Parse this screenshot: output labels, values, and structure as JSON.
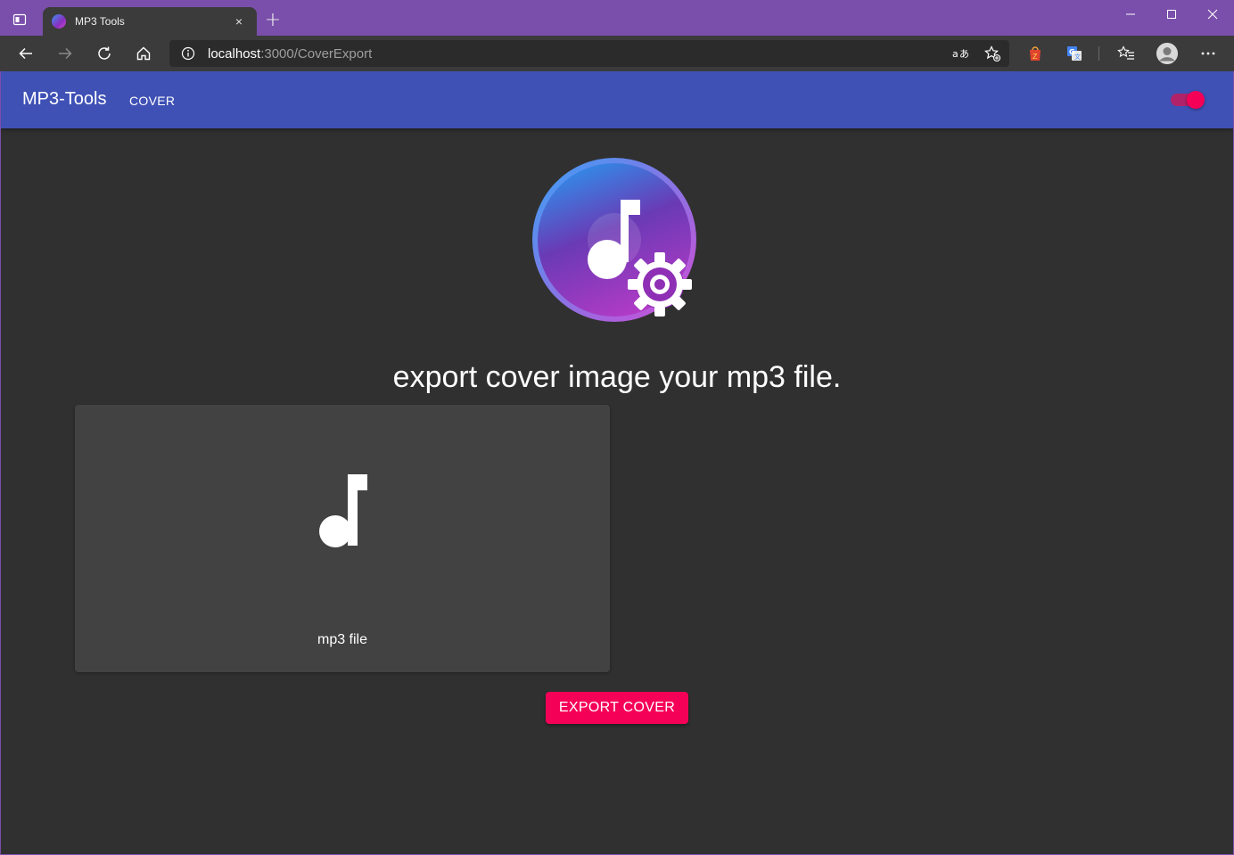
{
  "browser": {
    "tab_title": "MP3 Tools",
    "tab_close": "×",
    "new_tab": "+",
    "address_host": "localhost",
    "address_path": ":3000/CoverExport"
  },
  "app": {
    "title": "MP3-Tools",
    "nav_cover": "COVER",
    "theme_toggle_on": true
  },
  "main": {
    "headline": "export cover image your mp3 file.",
    "dropzone_label": "mp3 file",
    "export_button": "EXPORT COVER"
  },
  "colors": {
    "appbar": "#3f51b5",
    "accent": "#f50057",
    "background": "#303030",
    "card": "#424242",
    "window_frame": "#7a4fab"
  },
  "icons": [
    "tab-actions-icon",
    "app-favicon-icon",
    "minimize-icon",
    "maximize-icon",
    "close-window-icon",
    "back-icon",
    "forward-icon",
    "refresh-icon",
    "home-icon",
    "info-icon",
    "read-aloud-icon",
    "add-favorite-icon",
    "extension-icon",
    "translate-icon",
    "favorites-icon",
    "profile-icon",
    "more-icon",
    "music-settings-logo",
    "music-note-icon"
  ]
}
